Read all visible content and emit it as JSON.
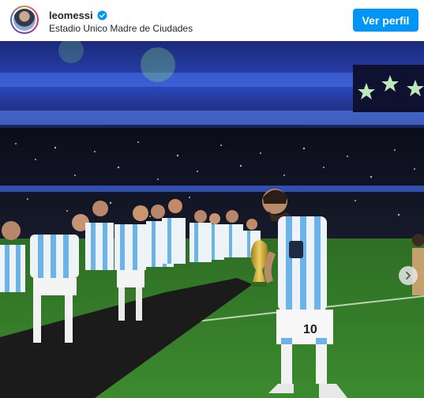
{
  "post": {
    "username": "leomessi",
    "location": "Estadio Unico Madre de Ciudades",
    "profile_button": "Ver perfil",
    "photo_jersey_number": "10"
  },
  "icons": {
    "verified": "verified-badge-icon",
    "next": "chevron-right-icon",
    "stars": "star-icon"
  },
  "colors": {
    "button": "#0095f6",
    "verified": "#0095f6",
    "pitch": "#2f7a2a",
    "stadium_lights": "#3a5bd9",
    "jersey_blue": "#6cb4e8"
  }
}
